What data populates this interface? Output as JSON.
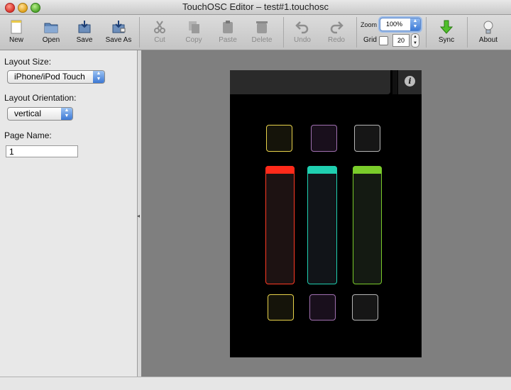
{
  "window": {
    "title": "TouchOSC Editor – test#1.touchosc"
  },
  "toolbar": {
    "new_label": "New",
    "open_label": "Open",
    "save_label": "Save",
    "saveas_label": "Save As",
    "cut_label": "Cut",
    "copy_label": "Copy",
    "paste_label": "Paste",
    "delete_label": "Delete",
    "undo_label": "Undo",
    "redo_label": "Redo",
    "zoom_label": "Zoom",
    "zoom_value": "100%",
    "grid_label": "Grid",
    "grid_value": "20",
    "sync_label": "Sync",
    "about_label": "About"
  },
  "side": {
    "layout_size_label": "Layout Size:",
    "layout_size_value": "iPhone/iPod Touch",
    "orientation_label": "Layout Orientation:",
    "orientation_value": "vertical",
    "page_name_label": "Page Name:",
    "page_name_value": "1"
  },
  "device": {
    "info_glyph": "i",
    "colors": {
      "yellow": "#e8d24a",
      "purple": "#a070b0",
      "gray": "#b5b5b5",
      "red": "#ff2a1a",
      "teal": "#1fcfb0",
      "green": "#7acc2a"
    }
  }
}
